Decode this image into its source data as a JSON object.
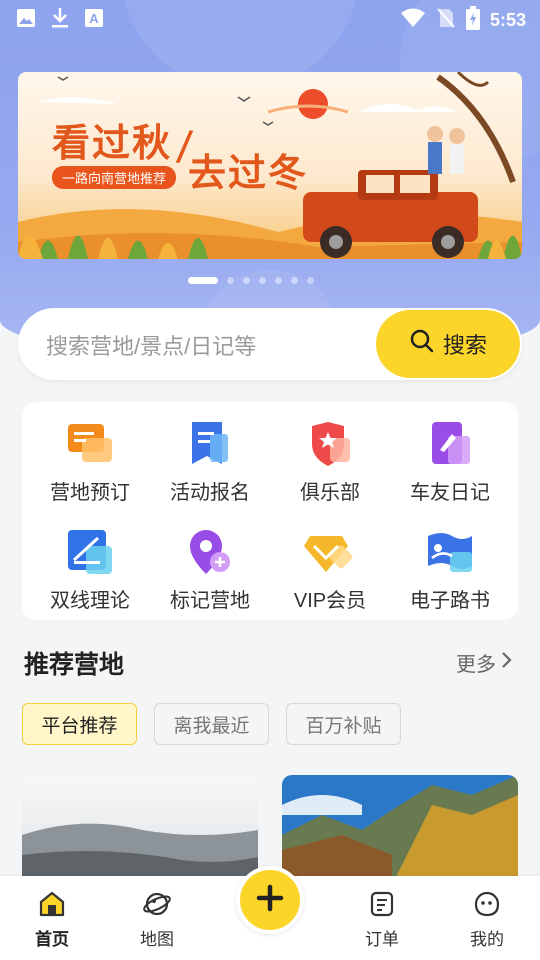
{
  "status_bar": {
    "time": "5:53",
    "left_icons": [
      "gallery-icon",
      "download-icon",
      "translate-icon"
    ],
    "right_icons": [
      "wifi-icon",
      "no-sim-icon",
      "battery-charging-icon"
    ]
  },
  "banner": {
    "headline_left": "看过秋",
    "headline_right": "去过冬",
    "tagline": "一路向南营地推荐",
    "slide_count": 7,
    "active_slide": 1
  },
  "search": {
    "placeholder": "搜索营地/景点/日记等",
    "button_label": "搜索"
  },
  "features": [
    {
      "label": "营地预订",
      "icon": "camp-booking-icon"
    },
    {
      "label": "活动报名",
      "icon": "activity-signup-icon"
    },
    {
      "label": "俱乐部",
      "icon": "club-shield-icon"
    },
    {
      "label": "车友日记",
      "icon": "diary-icon"
    },
    {
      "label": "双线理论",
      "icon": "double-line-icon"
    },
    {
      "label": "标记营地",
      "icon": "mark-location-icon"
    },
    {
      "label": "VIP会员",
      "icon": "vip-diamond-icon"
    },
    {
      "label": "电子路书",
      "icon": "road-book-icon"
    }
  ],
  "recommend": {
    "title": "推荐营地",
    "more": "更多",
    "chips": [
      "平台推荐",
      "离我最近",
      "百万补贴"
    ],
    "active_chip": 0
  },
  "tabbar": {
    "items": [
      {
        "label": "首页",
        "icon": "home-icon",
        "active": true
      },
      {
        "label": "地图",
        "icon": "map-planet-icon",
        "active": false
      },
      {
        "label": "订单",
        "icon": "order-icon",
        "active": false
      },
      {
        "label": "我的",
        "icon": "profile-icon",
        "active": false
      }
    ],
    "fab_icon": "plus-icon"
  },
  "colors": {
    "accent_yellow": "#fbd52a",
    "hero_blue": "#8ea3ee",
    "banner_orange": "#e2571b"
  }
}
